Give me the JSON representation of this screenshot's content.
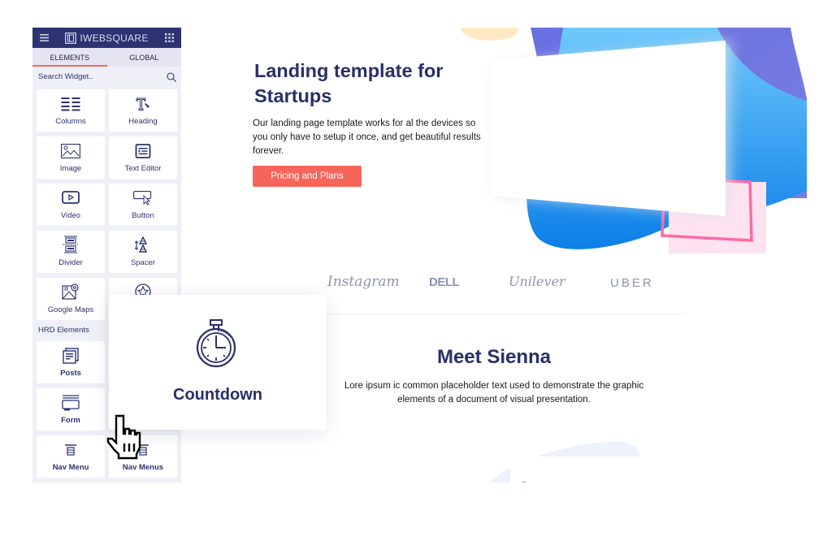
{
  "sidebar": {
    "brand": "IWEBSQUARE",
    "tabs": [
      {
        "label": "ELEMENTS",
        "active": true
      },
      {
        "label": "GLOBAL",
        "active": false
      }
    ],
    "search_placeholder": "Search Widget..",
    "widgets": [
      {
        "label": "Columns",
        "icon": "columns-icon"
      },
      {
        "label": "Heading",
        "icon": "heading-icon"
      },
      {
        "label": "Image",
        "icon": "image-icon"
      },
      {
        "label": "Text Editor",
        "icon": "text-editor-icon"
      },
      {
        "label": "Video",
        "icon": "video-icon"
      },
      {
        "label": "Button",
        "icon": "button-icon"
      },
      {
        "label": "Divider",
        "icon": "divider-icon"
      },
      {
        "label": "Spacer",
        "icon": "spacer-icon"
      },
      {
        "label": "Google Maps",
        "icon": "map-icon"
      },
      {
        "label": "",
        "icon": "star-icon"
      }
    ],
    "section_label": "HRD Elements",
    "hrd_widgets": [
      {
        "label": "Posts",
        "icon": "posts-icon"
      },
      {
        "label": "Form",
        "icon": "form-icon"
      },
      {
        "label": "Nav Menu",
        "icon": "nav-menu-icon"
      },
      {
        "label": "Nav Menus",
        "icon": "nav-menu-icon"
      }
    ]
  },
  "drag_preview": {
    "label": "Countdown",
    "icon": "stopwatch-icon"
  },
  "hero": {
    "title": "Landing template for Startups",
    "text": "Our landing page template works for al the devices so you only have to setup it once, and get beautiful results forever.",
    "cta_label": "Pricing and Plans"
  },
  "logos": [
    "Instagram",
    "DELL",
    "Unilever",
    "UBER"
  ],
  "meet": {
    "title": "Meet Sienna",
    "text": "Lore ipsum ic common placeholder text used to demonstrate the graphic elements of a document of visual presentation."
  },
  "colors": {
    "navy": "#283066",
    "accent": "#f7655a",
    "sidebar_bg": "#eff0f7"
  }
}
